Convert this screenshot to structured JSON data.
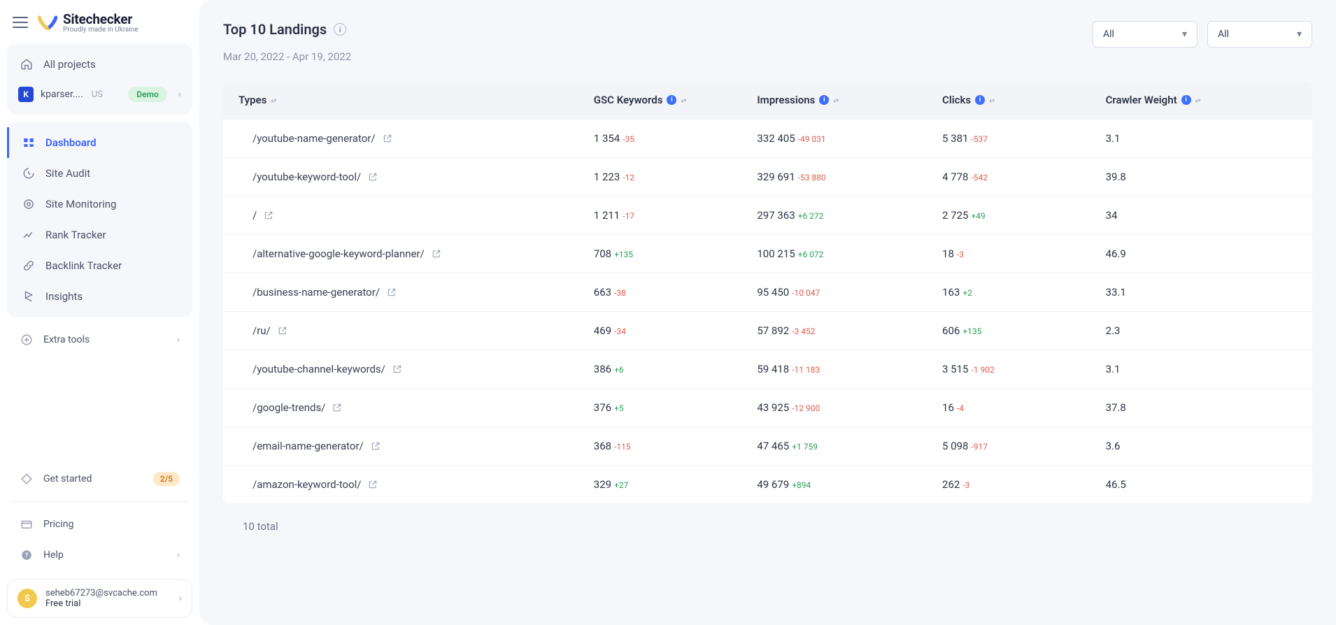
{
  "brand": {
    "name": "Sitechecker",
    "tagline": "Proudly made in Ukraine"
  },
  "sidebar": {
    "allProjects": "All projects",
    "project": {
      "initial": "K",
      "name": "kparser....",
      "country": "US",
      "demo": "Demo"
    },
    "nav": [
      {
        "label": "Dashboard",
        "active": true
      },
      {
        "label": "Site Audit",
        "active": false
      },
      {
        "label": "Site Monitoring",
        "active": false
      },
      {
        "label": "Rank Tracker",
        "active": false
      },
      {
        "label": "Backlink Tracker",
        "active": false
      },
      {
        "label": "Insights",
        "active": false
      }
    ],
    "extraTools": "Extra tools",
    "getStarted": {
      "label": "Get started",
      "count": "2/5"
    },
    "pricing": "Pricing",
    "help": "Help",
    "user": {
      "initial": "S",
      "email": "seheb67273@svcache.com",
      "plan": "Free trial"
    }
  },
  "page": {
    "title": "Top 10 Landings",
    "dateRange": "Mar 20, 2022 - Apr 19, 2022",
    "filter1": "All",
    "filter2": "All",
    "columns": {
      "types": "Types",
      "gsc": "GSC Keywords",
      "impressions": "Impressions",
      "clicks": "Clicks",
      "weight": "Crawler Weight"
    },
    "rows": [
      {
        "path": "/youtube-name-generator/",
        "kw": "1 354",
        "kwD": "-35",
        "imp": "332 405",
        "impD": "-49 031",
        "clk": "5 381",
        "clkD": "-537",
        "w": "3.1"
      },
      {
        "path": "/youtube-keyword-tool/",
        "kw": "1 223",
        "kwD": "-12",
        "imp": "329 691",
        "impD": "-53 880",
        "clk": "4 778",
        "clkD": "-542",
        "w": "39.8"
      },
      {
        "path": "/",
        "kw": "1 211",
        "kwD": "-17",
        "imp": "297 363",
        "impD": "+6 272",
        "clk": "2 725",
        "clkD": "+49",
        "w": "34"
      },
      {
        "path": "/alternative-google-keyword-planner/",
        "kw": "708",
        "kwD": "+135",
        "imp": "100 215",
        "impD": "+6 072",
        "clk": "18",
        "clkD": "-3",
        "w": "46.9"
      },
      {
        "path": "/business-name-generator/",
        "kw": "663",
        "kwD": "-38",
        "imp": "95 450",
        "impD": "-10 047",
        "clk": "163",
        "clkD": "+2",
        "w": "33.1"
      },
      {
        "path": "/ru/",
        "kw": "469",
        "kwD": "-34",
        "imp": "57 892",
        "impD": "-3 452",
        "clk": "606",
        "clkD": "+135",
        "w": "2.3"
      },
      {
        "path": "/youtube-channel-keywords/",
        "kw": "386",
        "kwD": "+6",
        "imp": "59 418",
        "impD": "-11 183",
        "clk": "3 515",
        "clkD": "-1 902",
        "w": "3.1"
      },
      {
        "path": "/google-trends/",
        "kw": "376",
        "kwD": "+5",
        "imp": "43 925",
        "impD": "-12 900",
        "clk": "16",
        "clkD": "-4",
        "w": "37.8"
      },
      {
        "path": "/email-name-generator/",
        "kw": "368",
        "kwD": "-115",
        "imp": "47 465",
        "impD": "+1 759",
        "clk": "5 098",
        "clkD": "-917",
        "w": "3.6"
      },
      {
        "path": "/amazon-keyword-tool/",
        "kw": "329",
        "kwD": "+27",
        "imp": "49 679",
        "impD": "+894",
        "clk": "262",
        "clkD": "-3",
        "w": "46.5"
      }
    ],
    "totals": "10 total"
  }
}
